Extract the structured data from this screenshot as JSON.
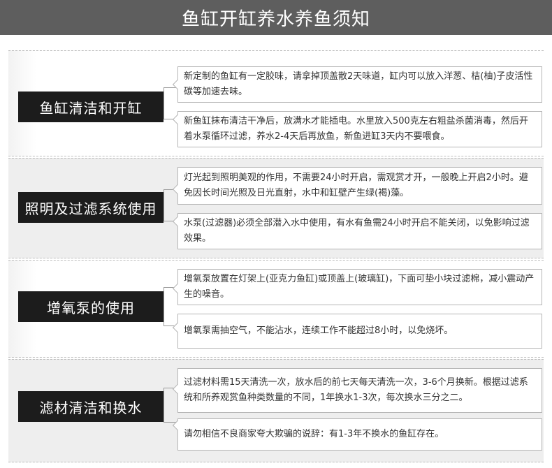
{
  "page_title": "鱼缸开缸养水养鱼须知",
  "sections": [
    {
      "label": "鱼缸清洁和开缸",
      "items": [
        "新定制的鱼缸有一定胶味，请拿掉顶盖散2天味道，缸内可以放入洋葱、桔(柚)子皮活性碳等加速去味。",
        "新鱼缸抹布清洁干净后，放满水才能插电。水里放入500克左右粗盐杀菌消毒，然后开着水泵循环过滤，养水2-4天后再放鱼，新鱼进缸3天内不要喂食。"
      ]
    },
    {
      "label": "照明及过滤系统使用",
      "items": [
        "灯光起到照明美观的作用，不需要24小时开启，需观赏才开，一般晚上开启2小时。避免因长时间光照及日光直射，水中和缸壁产生绿(褐)藻。",
        "水泵(过滤器)必须全部潜入水中使用，有水有鱼需24小时开启不能关闭，以免影响过滤效果。"
      ]
    },
    {
      "label": "增氧泵的使用",
      "items": [
        "增氧泵放置在灯架上(亚克力鱼缸)或顶盖上(玻璃缸)，下面可垫小块过滤棉，减小震动产生的噪音。",
        "增氧泵需抽空气，不能沾水，连续工作不能超过8小时，以免烧坏。"
      ]
    },
    {
      "label": "滤材清洁和换水",
      "items": [
        "过滤材料需15天清洗一次，放水后的前七天每天清洗一次，3-6个月换新。根据过滤系统和所养观赏鱼种类数量的不同，1年换水1-3次，每次换水三分之二。",
        "请勿相信不良商家夸大欺骗的说辞：有1-3年不换水的鱼缸存在。"
      ]
    }
  ]
}
